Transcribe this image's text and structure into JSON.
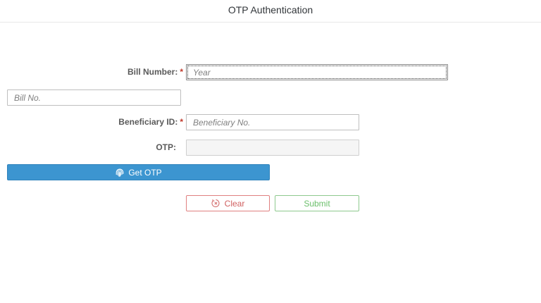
{
  "header": {
    "title": "OTP Authentication"
  },
  "form": {
    "bill_number": {
      "label": "Bill Number:",
      "required_marker": "*",
      "year_placeholder": "Year",
      "year_value": "",
      "bill_no_placeholder": "Bill No.",
      "bill_no_value": ""
    },
    "beneficiary_id": {
      "label": "Beneficiary ID:",
      "required_marker": "*",
      "placeholder": "Beneficiary No.",
      "value": ""
    },
    "otp": {
      "label": "OTP:",
      "value": "",
      "disabled": true
    }
  },
  "buttons": {
    "get_otp": {
      "label": "Get OTP",
      "icon": "fingerprint-icon",
      "color": "#3c95d0"
    },
    "clear": {
      "label": "Clear",
      "icon": "clear-circle-icon",
      "color": "#d06060"
    },
    "submit": {
      "label": "Submit",
      "color": "#6bbf6b"
    }
  }
}
